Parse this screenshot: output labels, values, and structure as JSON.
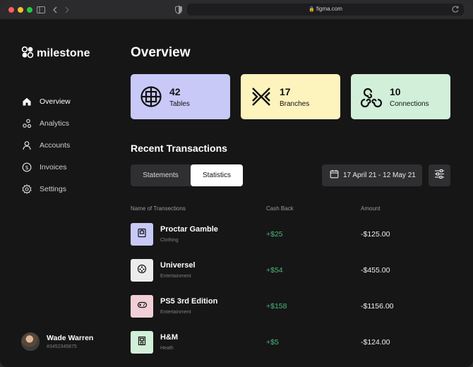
{
  "browser": {
    "url": "figma.com",
    "traffic_light_colors": [
      "#ff5f57",
      "#febc2e",
      "#28c840"
    ]
  },
  "brand": {
    "name": "milestone"
  },
  "sidebar": {
    "items": [
      {
        "label": "Overview",
        "icon": "home-icon",
        "active": true
      },
      {
        "label": "Analytics",
        "icon": "analytics-icon",
        "active": false
      },
      {
        "label": "Accounts",
        "icon": "user-icon",
        "active": false
      },
      {
        "label": "Invoices",
        "icon": "dollar-coin-icon",
        "active": false
      },
      {
        "label": "Settings",
        "icon": "gear-icon",
        "active": false
      }
    ]
  },
  "profile": {
    "name": "Wade Warren",
    "id": "#3452345875"
  },
  "page": {
    "title": "Overview"
  },
  "stats": [
    {
      "value": "42",
      "label": "Tables",
      "color": "#c8c9f7",
      "icon": "tables-icon"
    },
    {
      "value": "17",
      "label": "Branches",
      "color": "#fdf3bd",
      "icon": "branches-icon"
    },
    {
      "value": "10",
      "label": "Connections",
      "color": "#d2efd9",
      "icon": "connections-icon"
    }
  ],
  "transactions": {
    "title": "Recent Transactions",
    "tabs": [
      "Statements",
      "Statistics"
    ],
    "active_tab": "Statistics",
    "date_range": "17 April 21 - 12 May 21",
    "columns": [
      "Name of Transections",
      "Cash Back",
      "Amount"
    ],
    "rows": [
      {
        "name": "Proctar Gamble",
        "category": "Clothing",
        "cash_back": "+$25",
        "amount": "-$125.00",
        "icon": "shirt-icon",
        "color": "#c8c9f7"
      },
      {
        "name": "Universel",
        "category": "Entertainment",
        "cash_back": "+$54",
        "amount": "-$455.00",
        "icon": "film-reel-icon",
        "color": "#ececec"
      },
      {
        "name": "PS5 3rd Edition",
        "category": "Entertainment",
        "cash_back": "+$158",
        "amount": "-$1156.00",
        "icon": "gamepad-icon",
        "color": "#f1cfd6"
      },
      {
        "name": "H&M",
        "category": "Heath",
        "cash_back": "+$5",
        "amount": "-$124.00",
        "icon": "store-icon",
        "color": "#d2efd9"
      }
    ]
  },
  "colors": {
    "background": "#161616",
    "panel": "#2f2f31",
    "positive": "#49b77a"
  }
}
